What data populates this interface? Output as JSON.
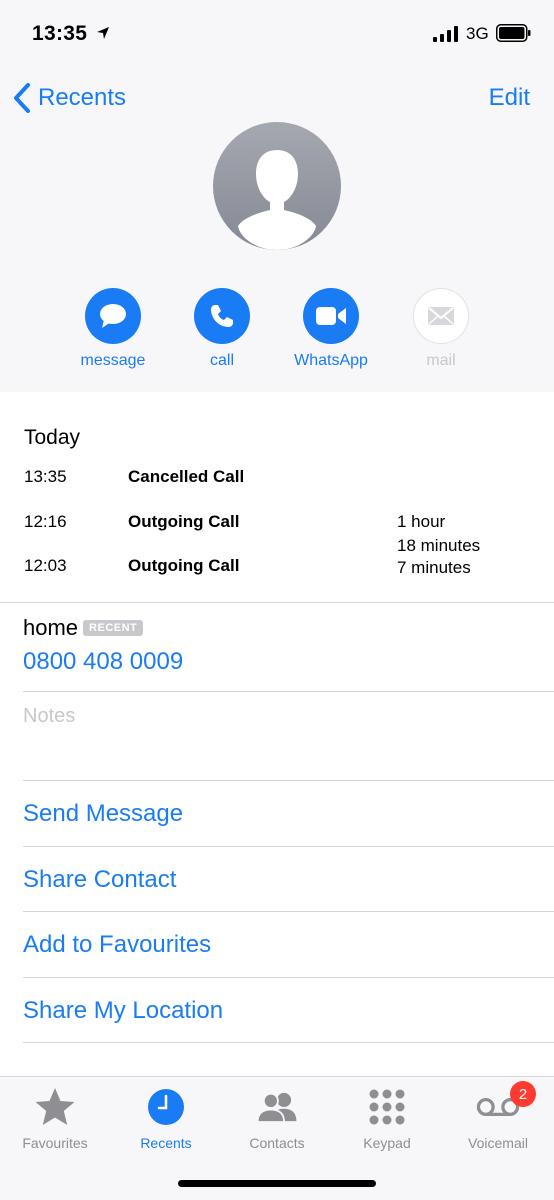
{
  "status_bar": {
    "time": "13:35",
    "network": "3G",
    "icons": [
      "location-arrow-icon",
      "signal-icon",
      "battery-icon"
    ]
  },
  "nav": {
    "back_label": "Recents",
    "edit_label": "Edit"
  },
  "contact": {
    "avatar_icon": "person-silhouette-icon"
  },
  "actions": [
    {
      "label": "message",
      "icon": "message-bubble-icon",
      "enabled": true
    },
    {
      "label": "call",
      "icon": "phone-icon",
      "enabled": true
    },
    {
      "label": "WhatsApp",
      "icon": "video-camera-icon",
      "enabled": true
    },
    {
      "label": "mail",
      "icon": "envelope-icon",
      "enabled": false
    }
  ],
  "call_history": {
    "title": "Today",
    "calls": [
      {
        "time": "13:35",
        "type": "Cancelled Call",
        "duration": ""
      },
      {
        "time": "12:16",
        "type": "Outgoing Call",
        "duration_line1": "1 hour",
        "duration_line2": "18 minutes"
      },
      {
        "time": "12:03",
        "type": "Outgoing Call",
        "duration": "7 minutes"
      }
    ]
  },
  "phone": {
    "label": "home",
    "badge": "RECENT",
    "number": "0800 408 0009"
  },
  "notes": {
    "placeholder": "Notes"
  },
  "menu": [
    {
      "label": "Send Message"
    },
    {
      "label": "Share Contact"
    },
    {
      "label": "Add to Favourites"
    },
    {
      "label": "Share My Location"
    }
  ],
  "tabs": [
    {
      "label": "Favourites",
      "icon": "star-icon",
      "active": false
    },
    {
      "label": "Recents",
      "icon": "clock-icon",
      "active": true
    },
    {
      "label": "Contacts",
      "icon": "contacts-icon",
      "active": false
    },
    {
      "label": "Keypad",
      "icon": "keypad-icon",
      "active": false
    },
    {
      "label": "Voicemail",
      "icon": "voicemail-icon",
      "active": false,
      "badge": "2"
    }
  ],
  "colors": {
    "accent": "#1a7cf5",
    "badge_red": "#ff3b30",
    "inactive_gray": "#8e8e93"
  }
}
